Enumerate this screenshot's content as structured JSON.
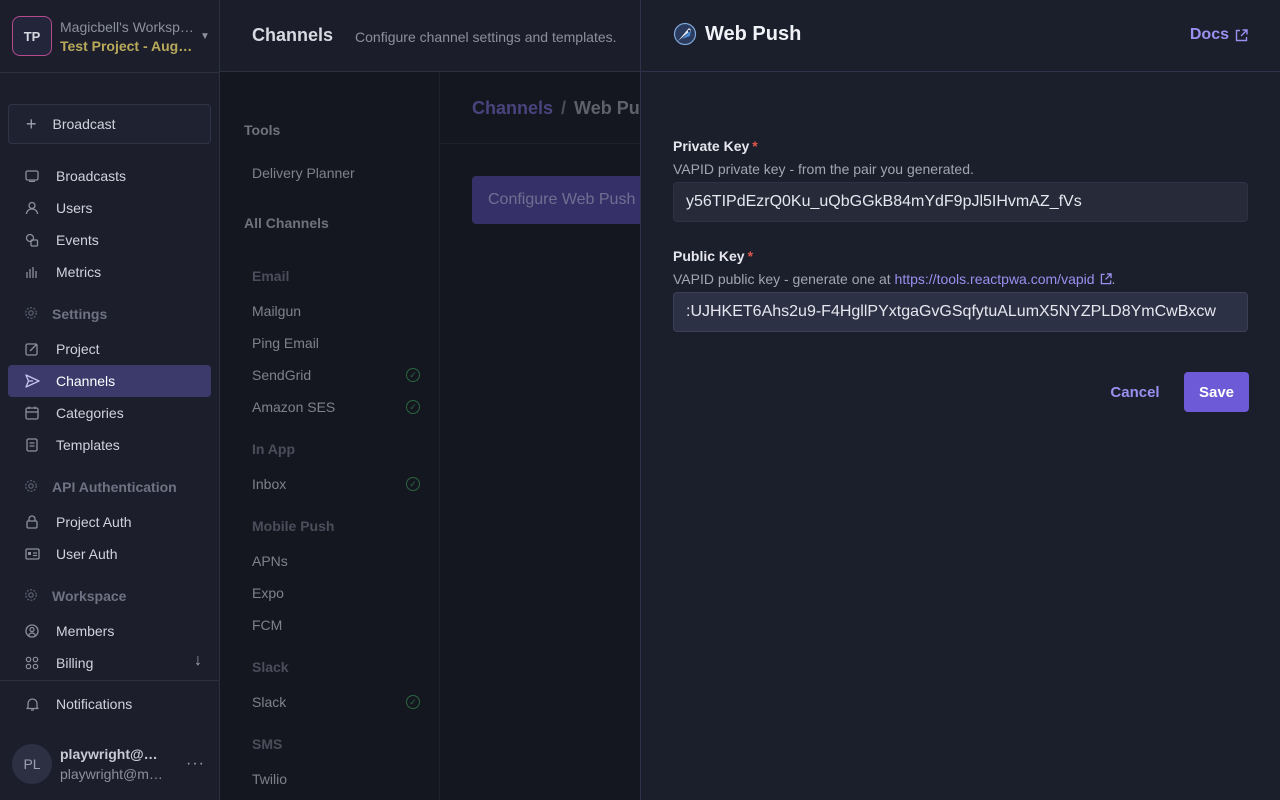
{
  "workspace": {
    "initials": "TP",
    "name": "Magicbell's Workspace",
    "project": "Test Project - August"
  },
  "sidebar": {
    "broadcast_label": "Broadcast",
    "items": [
      {
        "label": "Broadcasts",
        "icon": "inbox-icon"
      },
      {
        "label": "Users",
        "icon": "user-icon"
      },
      {
        "label": "Events",
        "icon": "events-icon"
      },
      {
        "label": "Metrics",
        "icon": "metrics-icon"
      }
    ],
    "settings_label": "Settings",
    "settings_items": [
      {
        "label": "Project",
        "icon": "edit-icon"
      },
      {
        "label": "Channels",
        "icon": "send-icon",
        "active": true
      },
      {
        "label": "Categories",
        "icon": "calendar-icon"
      },
      {
        "label": "Templates",
        "icon": "document-icon"
      }
    ],
    "api_label": "API Authentication",
    "api_items": [
      {
        "label": "Project Auth",
        "icon": "lock-icon"
      },
      {
        "label": "User Auth",
        "icon": "id-card-icon"
      }
    ],
    "workspace_label": "Workspace",
    "workspace_items": [
      {
        "label": "Members",
        "icon": "members-icon"
      },
      {
        "label": "Billing",
        "icon": "grid-icon"
      }
    ],
    "notifications_label": "Notifications"
  },
  "user": {
    "initials": "PL",
    "name": "playwright@magicbell.com",
    "email": "playwright@magicbell.com"
  },
  "header": {
    "title": "Channels",
    "subtitle": "Configure channel settings and templates."
  },
  "channels": {
    "tools_label": "Tools",
    "delivery_planner": "Delivery Planner",
    "all_channels_label": "All Channels",
    "groups": [
      {
        "name": "Email",
        "items": [
          {
            "label": "Mailgun",
            "configured": false
          },
          {
            "label": "Ping Email",
            "configured": false
          },
          {
            "label": "SendGrid",
            "configured": true
          },
          {
            "label": "Amazon SES",
            "configured": true
          }
        ]
      },
      {
        "name": "In App",
        "items": [
          {
            "label": "Inbox",
            "configured": true
          }
        ]
      },
      {
        "name": "Mobile Push",
        "items": [
          {
            "label": "APNs",
            "configured": false
          },
          {
            "label": "Expo",
            "configured": false
          },
          {
            "label": "FCM",
            "configured": false
          }
        ]
      },
      {
        "name": "Slack",
        "items": [
          {
            "label": "Slack",
            "configured": true
          }
        ]
      },
      {
        "name": "SMS",
        "items": [
          {
            "label": "Twilio",
            "configured": false
          }
        ]
      }
    ]
  },
  "content": {
    "breadcrumb_root": "Channels",
    "breadcrumb_sep": "/",
    "breadcrumb_current": "Web Push",
    "configure_button": "Configure Web Push"
  },
  "drawer": {
    "title": "Web Push",
    "docs_label": "Docs",
    "private_key": {
      "label": "Private Key",
      "required_mark": "*",
      "help": "VAPID private key - from the pair you generated.",
      "value": "y56TIPdEzrQ0Ku_uQbGGkB84mYdF9pJl5IHvmAZ_fVs"
    },
    "public_key": {
      "label": "Public Key",
      "required_mark": "*",
      "help_prefix": "VAPID public key - generate one at ",
      "help_link": "https://tools.reactpwa.com/vapid",
      "help_suffix": ".",
      "value": ":UJHKET6Ahs2u9-F4HgllPYxtgaGvGSqfytuALumX5NYZPLD8YmCwBxcw"
    },
    "cancel_label": "Cancel",
    "save_label": "Save"
  },
  "colors": {
    "accent": "#6c5ad6",
    "link": "#9b90f0",
    "required": "#e2574c",
    "success": "#3d9a5b"
  }
}
